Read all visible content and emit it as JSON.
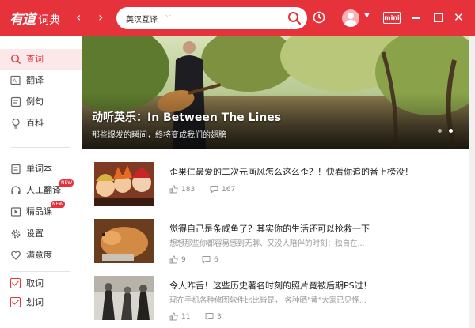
{
  "app": {
    "logo": "有道",
    "logo_sub": "词典"
  },
  "nav": {
    "back": "‹",
    "forward": "›"
  },
  "search": {
    "mode": "英汉互译",
    "query": ""
  },
  "toolbar": {
    "mini_label": "mini"
  },
  "sidebar": {
    "items": [
      {
        "label": "查词",
        "icon": "search-icon",
        "active": true
      },
      {
        "label": "翻译",
        "icon": "translate-icon"
      },
      {
        "label": "例句",
        "icon": "example-icon"
      },
      {
        "label": "百科",
        "icon": "bulb-icon"
      },
      {
        "label": "单词本",
        "icon": "wordbook-icon"
      },
      {
        "label": "人工翻译",
        "icon": "headset-icon",
        "badge": "NEW"
      },
      {
        "label": "精品课",
        "icon": "course-icon",
        "badge": "NEW"
      },
      {
        "label": "设置",
        "icon": "gear-icon"
      },
      {
        "label": "满意度",
        "icon": "heart-icon"
      },
      {
        "label": "取词",
        "icon": "checkbox-icon",
        "checked": true
      },
      {
        "label": "划词",
        "icon": "checkbox-icon",
        "checked": true
      }
    ]
  },
  "banner": {
    "title": "动听英乐：In Between The Lines",
    "subtitle": "那些爆发的瞬间，終将变成我们的翅膀",
    "slides": 2,
    "active_slide": 2
  },
  "feed": {
    "items": [
      {
        "title": "歪果仁最爱的二次元画风怎么这么歪？！快看你追的番上榜没！",
        "excerpt": "",
        "likes": "183",
        "comments": "167"
      },
      {
        "title": "觉得自己是条咸鱼了？其实你的生活还可以抢救一下",
        "excerpt": "想想那些你都容易感到无聊、又没人陪伴的时刻：独自在...",
        "likes": "9",
        "comments": "6"
      },
      {
        "title": "令人咋舌！这些历史著名时刻的照片竟被后期PS过！",
        "excerpt": "现在手机各种修图软件比比皆是， 各种晒\"黄\"大家已见怪...",
        "likes": "11",
        "comments": "3"
      }
    ]
  },
  "colors": {
    "accent": "#e5323b",
    "active_bg": "#fce8e8"
  }
}
